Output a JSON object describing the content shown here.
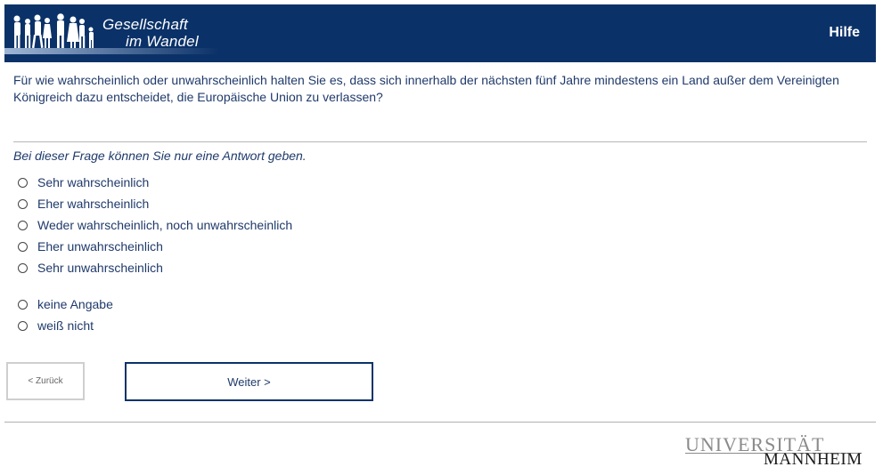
{
  "header": {
    "logo_line1": "Gesellschaft",
    "logo_line2": "im Wandel",
    "help_label": "Hilfe",
    "background": "#0b3268"
  },
  "question": {
    "text": "Für wie wahrscheinlich oder unwahrscheinlich halten Sie es, dass sich innerhalb der nächsten fünf Jahre mindestens ein Land außer dem Vereinigten Königreich dazu entscheidet, die Europäische Union zu verlassen?",
    "instruction": "Bei dieser Frage können Sie nur eine Antwort geben."
  },
  "options": [
    {
      "label": "Sehr wahrscheinlich"
    },
    {
      "label": "Eher wahrscheinlich"
    },
    {
      "label": "Weder wahrscheinlich, noch unwahrscheinlich"
    },
    {
      "label": "Eher unwahrscheinlich"
    },
    {
      "label": "Sehr unwahrscheinlich"
    },
    {
      "label": "keine Angabe"
    },
    {
      "label": "weiß nicht"
    }
  ],
  "nav": {
    "back_label": "< Zurück",
    "next_label": "Weiter >"
  },
  "footer": {
    "uni_line1": "UNIVERSITÄT",
    "uni_line2": "MANNHEIM"
  }
}
